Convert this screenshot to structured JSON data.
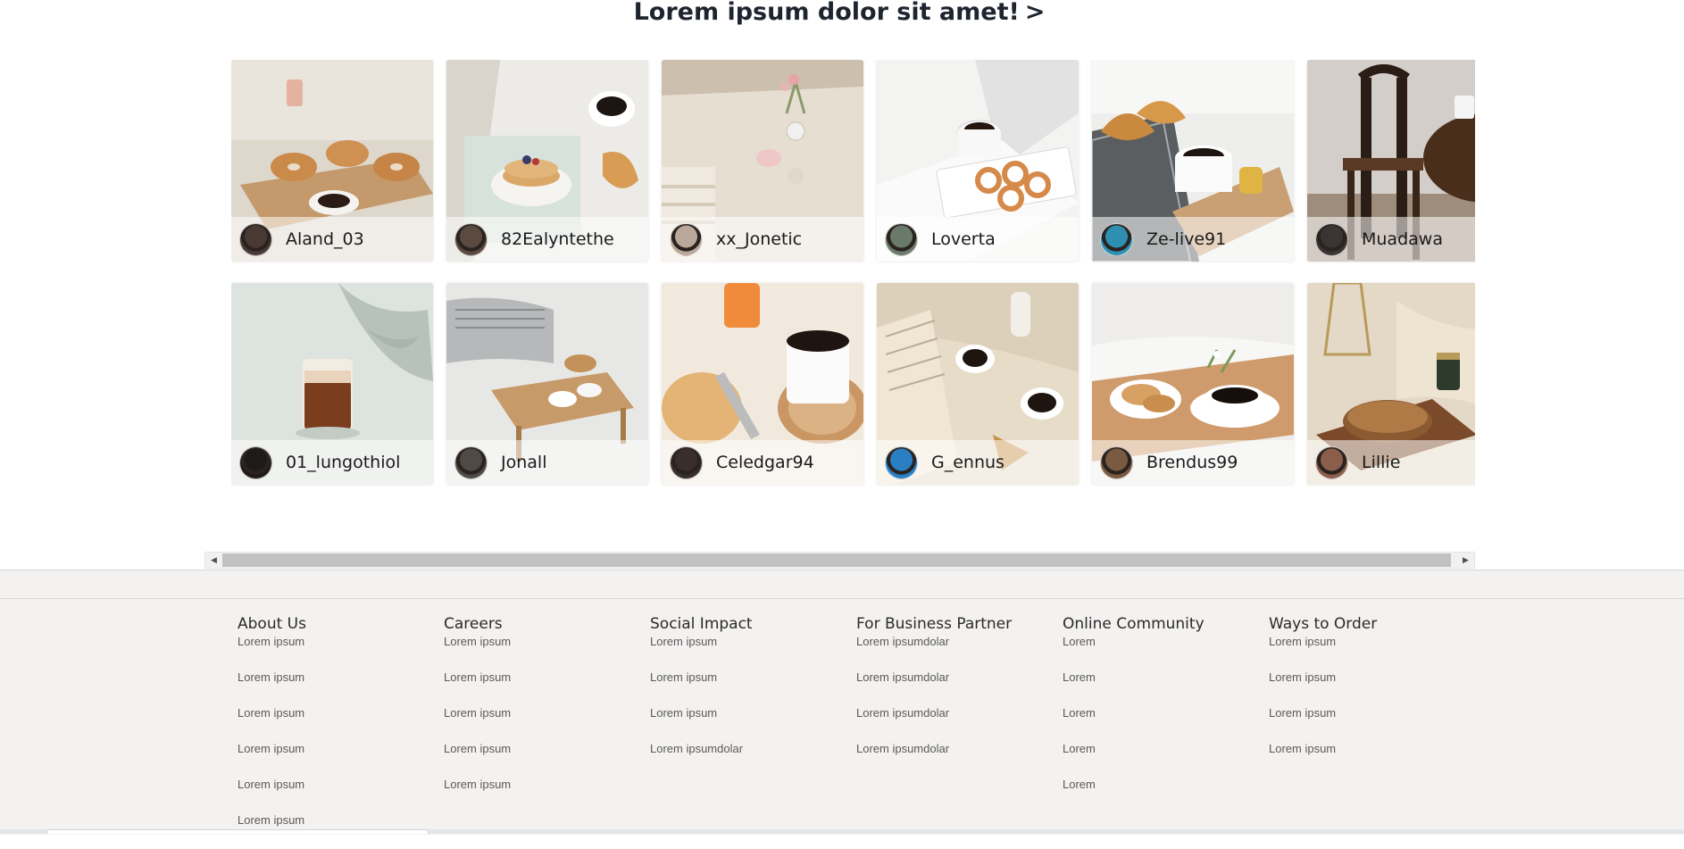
{
  "section": {
    "title": "Lorem ipsum dolor sit amet!",
    "arrow": ">"
  },
  "gallery": {
    "rows": [
      [
        {
          "user": "Aland_03",
          "photo": "bagels-coffee",
          "bg": "#e6e1d9",
          "avatar": "#4a3a34"
        },
        {
          "user": "82Ealyntethe",
          "photo": "pancakes-bed",
          "bg": "#ebe8e2",
          "avatar": "#5b4a40"
        },
        {
          "user": "xx_Jonetic",
          "photo": "table-cloth",
          "bg": "#d8cdbd",
          "avatar": "#b9a89a"
        },
        {
          "user": "Loverta",
          "photo": "cookies-cup",
          "bg": "#f2f2f2",
          "avatar": "#6a7a6a"
        },
        {
          "user": "Ze-live91",
          "photo": "croissant-tray",
          "bg": "#e8e6e2",
          "avatar": "#2f8fb0"
        },
        {
          "user": "Muadawa",
          "photo": "wooden-chair",
          "bg": "#cfc9c3",
          "avatar": "#3a3432"
        }
      ],
      [
        {
          "user": "01_lungothiol",
          "photo": "latte-glass",
          "bg": "#dfe4df",
          "avatar": "#1e1a1a"
        },
        {
          "user": "Jonall",
          "photo": "breakfast-bed",
          "bg": "#e7e6e4",
          "avatar": "#4f4a46"
        },
        {
          "user": "Celedgar94",
          "photo": "bread-coffee",
          "bg": "#efe6da",
          "avatar": "#3a2e2a"
        },
        {
          "user": "G_ennus",
          "photo": "book-coffee",
          "bg": "#e6dccb",
          "avatar": "#2a7fc4"
        },
        {
          "user": "Brendus99",
          "photo": "cookies-tray",
          "bg": "#f0eeec",
          "avatar": "#7a5a40"
        },
        {
          "user": "Lillie",
          "photo": "bread-board",
          "bg": "#e2d6c4",
          "avatar": "#8a5e4a"
        }
      ]
    ]
  },
  "footer": {
    "columns": [
      {
        "title": "About Us",
        "links": [
          "Lorem ipsum",
          "Lorem ipsum",
          "Lorem ipsum",
          "Lorem ipsum",
          "Lorem ipsum",
          "Lorem ipsum"
        ]
      },
      {
        "title": "Careers",
        "links": [
          "Lorem ipsum",
          "Lorem ipsum",
          "Lorem ipsum",
          "Lorem ipsum",
          "Lorem ipsum"
        ]
      },
      {
        "title": "Social Impact",
        "links": [
          "Lorem ipsum",
          "Lorem ipsum",
          "Lorem ipsum",
          "Lorem ipsumdolar"
        ]
      },
      {
        "title": "For Business Partner",
        "links": [
          "Lorem ipsumdolar",
          "Lorem ipsumdolar",
          "Lorem ipsumdolar",
          "Lorem ipsumdolar"
        ]
      },
      {
        "title": "Online Community",
        "links": [
          "Lorem",
          "Lorem",
          "Lorem",
          "Lorem",
          "Lorem"
        ]
      },
      {
        "title": "Ways to Order",
        "links": [
          "Lorem ipsum",
          "Lorem ipsum",
          "Lorem ipsum",
          "Lorem ipsum"
        ]
      }
    ]
  },
  "scrollbar": {
    "left_icon": "scroll-left-arrow-icon",
    "right_icon": "scroll-right-arrow-icon"
  }
}
